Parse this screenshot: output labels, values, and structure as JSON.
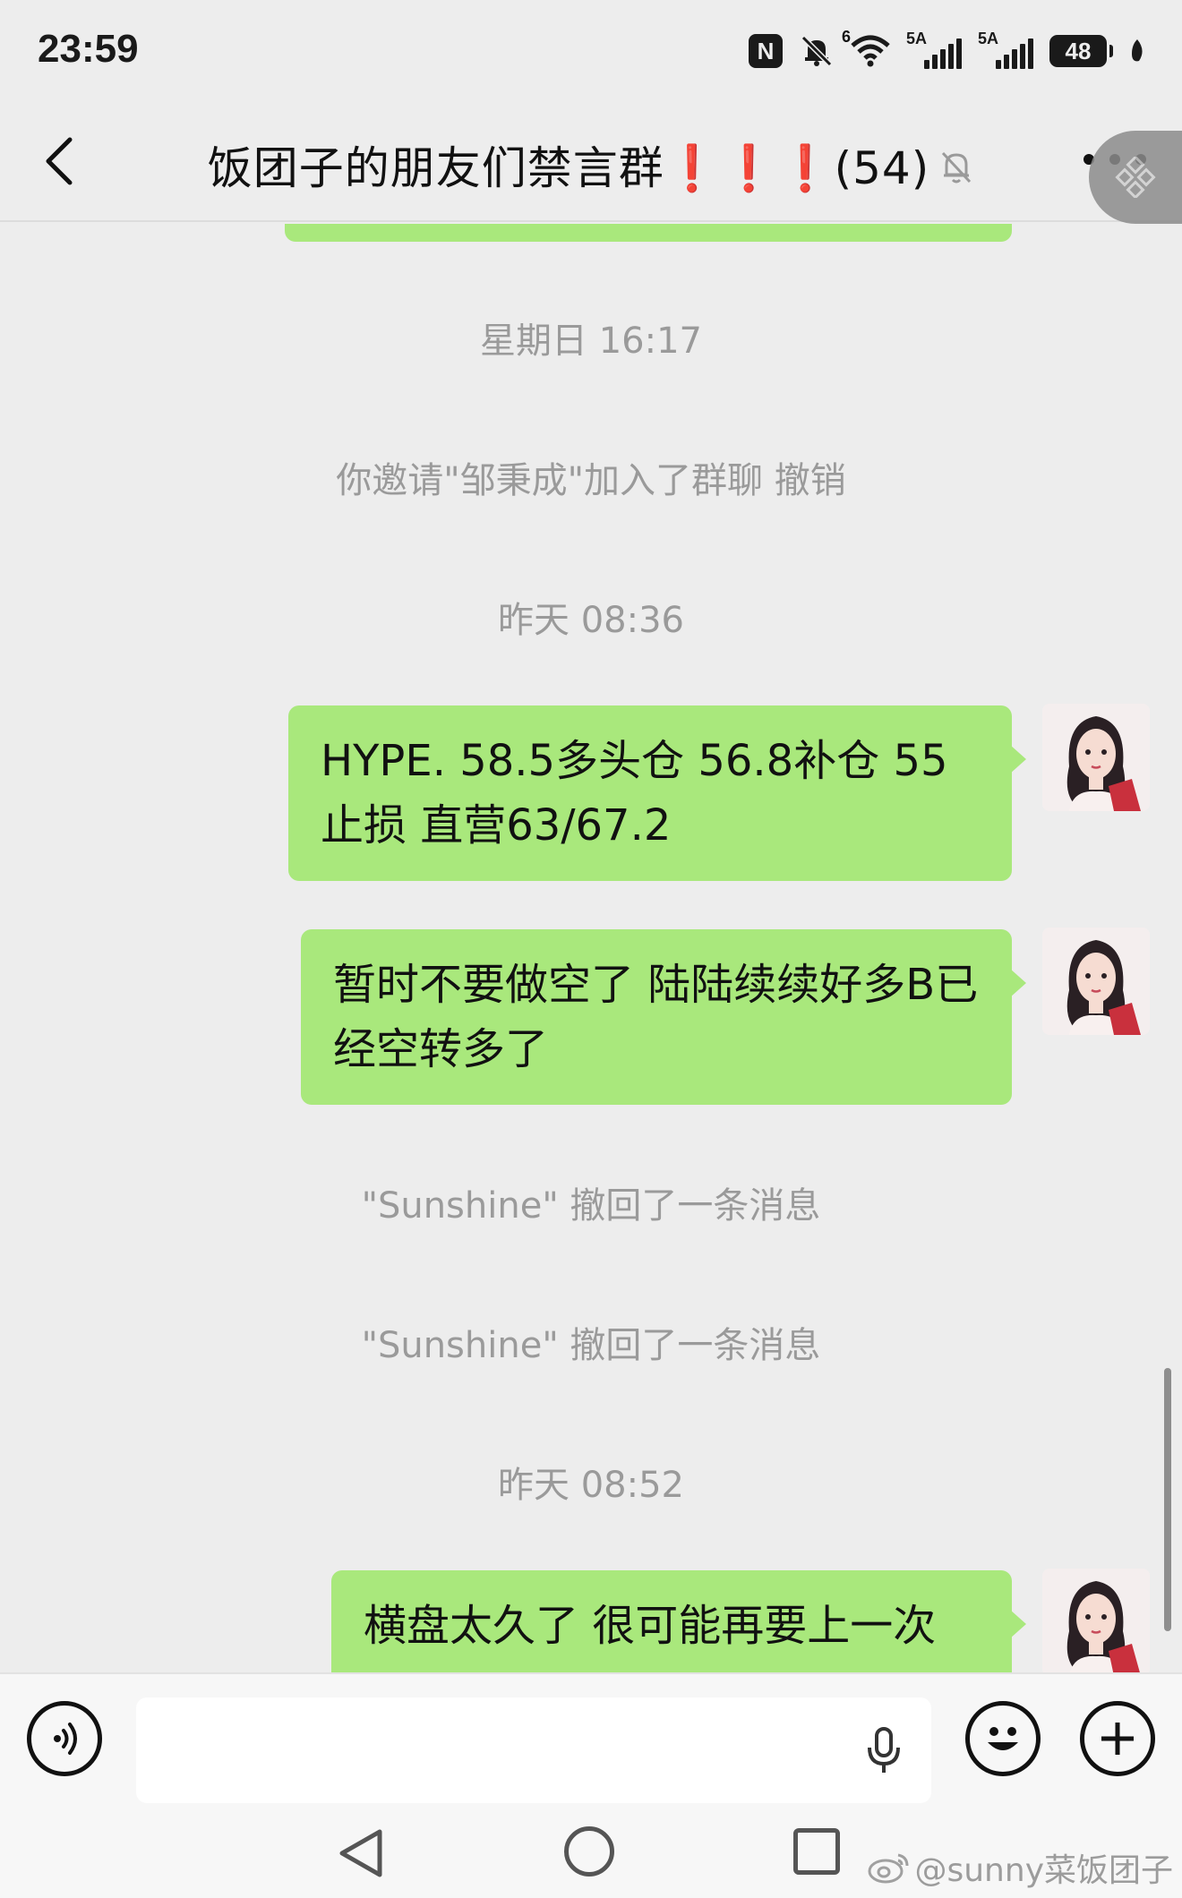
{
  "status_bar": {
    "time": "23:59",
    "nfc_label": "N",
    "wifi_label": "6",
    "signal1_label": "5A",
    "signal2_label": "5A",
    "battery": "48"
  },
  "header": {
    "title": "饭团子的朋友们禁言群❗❗❗(54)",
    "icons": [
      "back-arrow-icon",
      "mute-bell-icon",
      "more-icon"
    ]
  },
  "messages": {
    "sys1": "星期日 16:17",
    "sys2": "你邀请\"邹秉成\"加入了群聊  撤销",
    "sys3": "昨天 08:36",
    "bubble1": "HYPE. 58.5多头仓  56.8补仓   55止损    直营63/67.2",
    "bubble2": "暂时不要做空了  陆陆续续好多B已经空转多了",
    "sys4": "\"Sunshine\" 撤回了一条消息",
    "sys5": "\"Sunshine\" 撤回了一条消息",
    "sys6": "昨天 08:52",
    "bubble3": "横盘太久了  很可能再要上一次"
  },
  "input_bar": {
    "placeholder": "",
    "icons": [
      "voice-icon",
      "mic-icon",
      "emoji-icon",
      "plus-icon"
    ]
  },
  "nav": {
    "watermark": "@sunny菜饭团子"
  },
  "colors": {
    "bubble": "#a9e87c",
    "background": "#ededed",
    "system_text": "#9a9a9a"
  }
}
